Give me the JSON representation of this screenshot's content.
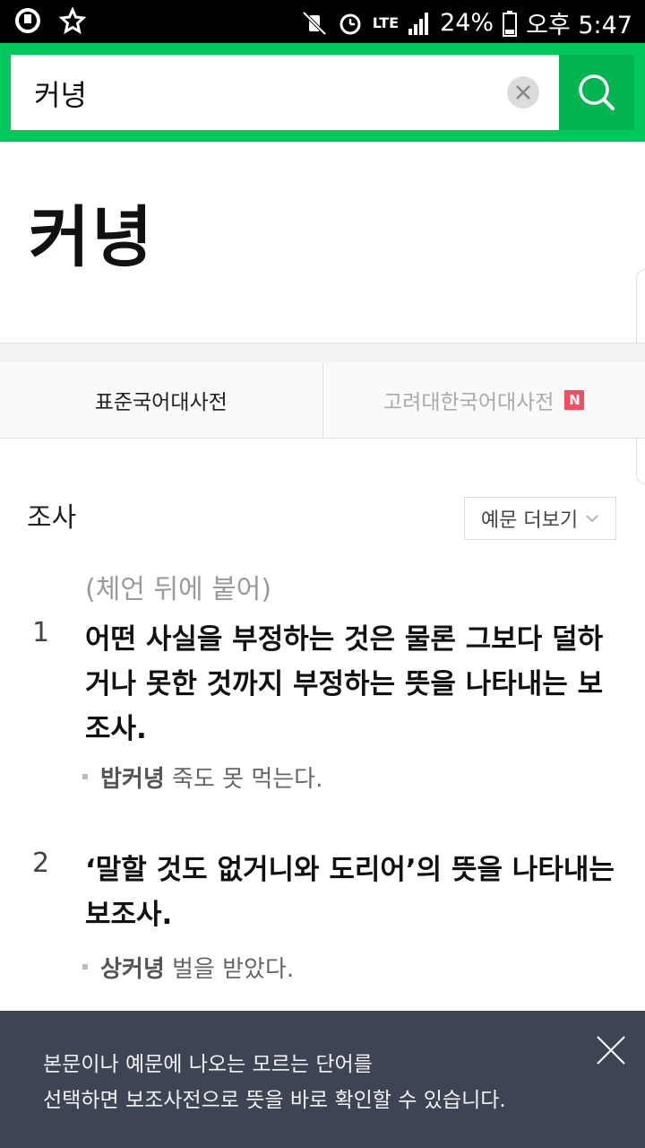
{
  "statusbar": {
    "network": "LTE",
    "battery": "24%",
    "time": "오후 5:47"
  },
  "search": {
    "value": "커녕",
    "clear_icon": "close-circle-icon",
    "search_icon": "search-icon"
  },
  "entry": {
    "headword": "커녕"
  },
  "tabs": [
    {
      "label": "표준국어대사전",
      "active": true
    },
    {
      "label": "고려대한국어대사전",
      "active": false,
      "badge": "N"
    }
  ],
  "definition": {
    "pos": "조사",
    "more_examples_label": "예문 더보기",
    "usage": "(체언 뒤에 붙어)",
    "senses": [
      {
        "num": "1",
        "text": "어떤 사실을 부정하는 것은 물론 그보다 덜하거나 못한 것까지 부정하는 뜻을 나타내는 보조사.",
        "example_head": "밥커녕",
        "example_rest": " 죽도 못 먹는다."
      },
      {
        "num": "2",
        "text": "‘말할 것도 없거니와 도리어’의 뜻을 나타내는 보조사.",
        "example_head": "상커녕",
        "example_rest": " 벌을 받았다."
      }
    ]
  },
  "toast": {
    "line1": "본문이나 예문에 나오는 모르는 단어를",
    "line2": "선택하면 보조사전으로 뜻을 바로 확인할 수 있습니다."
  },
  "colors": {
    "brand_green": "#03c75a",
    "toast_bg": "#3d4554",
    "badge_red": "#ef4f60"
  }
}
